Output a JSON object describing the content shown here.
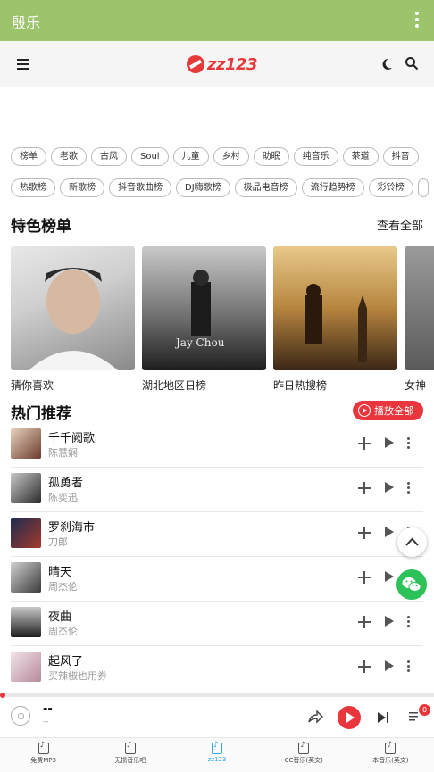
{
  "titlebar": {
    "title": "殷乐"
  },
  "header": {
    "logo_text": "zz123"
  },
  "chips_row1": [
    "榜单",
    "老歌",
    "古风",
    "Soul",
    "儿童",
    "乡村",
    "助眠",
    "纯音乐",
    "茶道",
    "抖音"
  ],
  "chips_row2": [
    "热歌榜",
    "新歌榜",
    "抖音歌曲榜",
    "DJ嗨歌榜",
    "极品电音榜",
    "流行趋势榜",
    "彩铃榜"
  ],
  "featured": {
    "title": "特色榜单",
    "view_all": "查看全部",
    "cards": [
      {
        "label": "猜你喜欢"
      },
      {
        "label": "湖北地区日榜"
      },
      {
        "label": "昨日热搜榜"
      },
      {
        "label": "女神"
      }
    ]
  },
  "hot": {
    "title": "热门推荐",
    "play_all": "播放全部",
    "songs": [
      {
        "name": "千千阙歌",
        "artist": "陈慧娴"
      },
      {
        "name": "孤勇者",
        "artist": "陈奕迅"
      },
      {
        "name": "罗刹海市",
        "artist": "刀郎"
      },
      {
        "name": "晴天",
        "artist": "周杰伦"
      },
      {
        "name": "夜曲",
        "artist": "周杰伦"
      },
      {
        "name": "起风了",
        "artist": "买辣椒也用券"
      }
    ]
  },
  "player": {
    "title": "--",
    "subtitle": "--",
    "queue_count": "0"
  },
  "tabs": [
    {
      "label": "免费MP3",
      "active": false
    },
    {
      "label": "无损音乐吧",
      "active": false
    },
    {
      "label": "zz123",
      "active": true
    },
    {
      "label": "CC音乐(英文)",
      "active": false
    },
    {
      "label": "本音乐(英文)",
      "active": false
    }
  ],
  "colors": {
    "titlebar": "#9cc46d",
    "accent": "#e8363c",
    "active_tab": "#2fa8e0",
    "wechat": "#2dc15a"
  }
}
